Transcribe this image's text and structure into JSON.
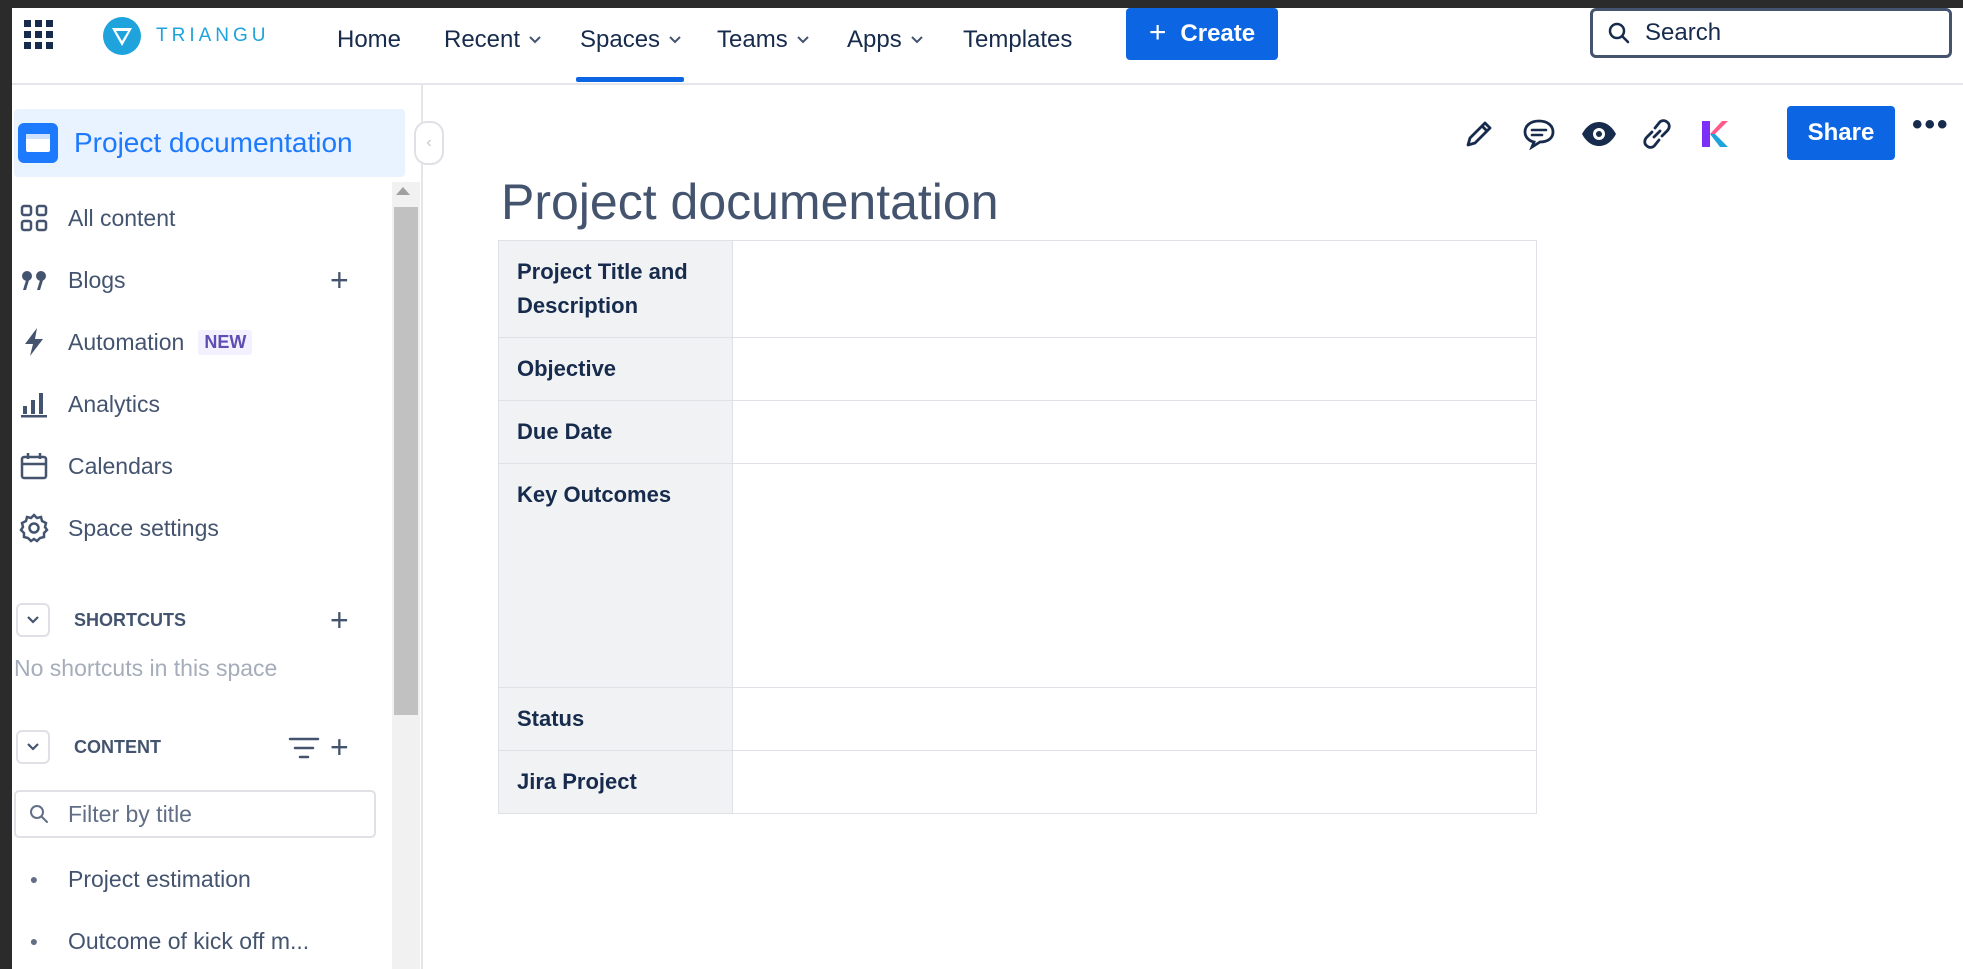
{
  "topnav": {
    "logo_text": "TRIANGU",
    "items": [
      {
        "label": "Home",
        "dropdown": false
      },
      {
        "label": "Recent",
        "dropdown": true
      },
      {
        "label": "Spaces",
        "dropdown": true,
        "active": true
      },
      {
        "label": "Teams",
        "dropdown": true
      },
      {
        "label": "Apps",
        "dropdown": true
      },
      {
        "label": "Templates",
        "dropdown": false
      }
    ],
    "create_label": "Create",
    "search_placeholder": "Search"
  },
  "sidebar": {
    "space_title": "Project documentation",
    "items": [
      {
        "label": "All content",
        "icon": "grid-icon"
      },
      {
        "label": "Blogs",
        "icon": "quote-icon"
      },
      {
        "label": "Automation",
        "icon": "lightning-icon",
        "badge": "NEW"
      },
      {
        "label": "Analytics",
        "icon": "bar-chart-icon"
      },
      {
        "label": "Calendars",
        "icon": "calendar-icon"
      },
      {
        "label": "Space settings",
        "icon": "gear-icon"
      }
    ],
    "shortcuts_label": "SHORTCUTS",
    "shortcuts_empty": "No shortcuts in this space",
    "content_label": "CONTENT",
    "filter_placeholder": "Filter by title",
    "tree": [
      {
        "label": "Project estimation"
      },
      {
        "label": "Outcome of kick off m..."
      }
    ]
  },
  "toolbar": {
    "share_label": "Share",
    "icons": [
      "pencil-icon",
      "comment-icon",
      "eye-icon",
      "link-icon",
      "app-k-icon",
      "more-icon"
    ]
  },
  "page": {
    "title": "Project documentation",
    "rows": [
      {
        "label": "Project Title and Description",
        "value": ""
      },
      {
        "label": "Objective",
        "value": ""
      },
      {
        "label": "Due Date",
        "value": ""
      },
      {
        "label": "Key Outcomes",
        "value": ""
      },
      {
        "label": "Status",
        "value": ""
      },
      {
        "label": "Jira Project",
        "value": ""
      }
    ]
  },
  "colors": {
    "primary": "#0c66e4",
    "space_accent": "#1d7afc",
    "text": "#172b4d",
    "muted_text": "#44546f"
  }
}
